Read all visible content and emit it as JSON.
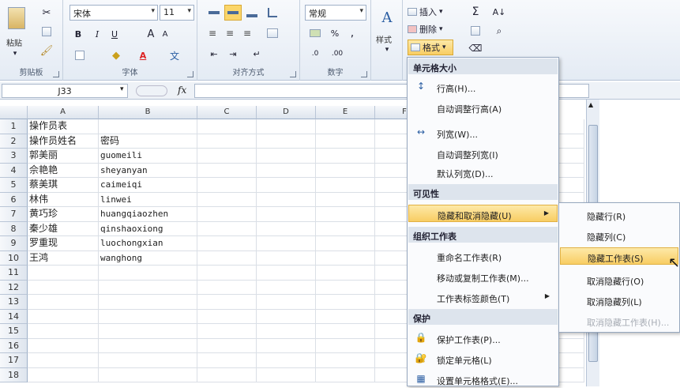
{
  "ribbon": {
    "clipboard": {
      "paste_label": "粘贴",
      "group_label": "剪贴板"
    },
    "font": {
      "font_name": "宋体",
      "font_size": "11",
      "bold": "B",
      "italic": "I",
      "underline": "U",
      "grow": "A",
      "shrink": "A",
      "group_label": "字体"
    },
    "alignment": {
      "group_label": "对齐方式"
    },
    "number": {
      "format_value": "常规",
      "percent": "%",
      "group_label": "数字"
    },
    "styles": {
      "label": "样式"
    },
    "cells": {
      "insert_label": "插入",
      "delete_label": "删除",
      "format_label": "格式"
    }
  },
  "formula_bar": {
    "name_box": "J33",
    "fx": "fx"
  },
  "columns": [
    "A",
    "B",
    "C",
    "D",
    "E",
    "F"
  ],
  "rows": [
    "1",
    "2",
    "3",
    "4",
    "5",
    "6",
    "7",
    "8",
    "9",
    "10",
    "11",
    "12",
    "13",
    "14",
    "15",
    "16",
    "17",
    "18"
  ],
  "cells": [
    {
      "a": "操作员表",
      "b": ""
    },
    {
      "a": "操作员姓名",
      "b": "密码"
    },
    {
      "a": "郭美丽",
      "b": "guomeili"
    },
    {
      "a": "佘艳艳",
      "b": "sheyanyan"
    },
    {
      "a": "蔡美琪",
      "b": "caimeiqi"
    },
    {
      "a": "林伟",
      "b": "linwei"
    },
    {
      "a": "黄巧珍",
      "b": "huangqiaozhen"
    },
    {
      "a": "秦少雄",
      "b": "qinshaoxiong"
    },
    {
      "a": "罗重现",
      "b": "luochongxian"
    },
    {
      "a": "王鸿",
      "b": "wanghong"
    }
  ],
  "format_menu": {
    "section_cell_size": "单元格大小",
    "row_height": "行高(H)...",
    "autofit_row": "自动调整行高(A)",
    "col_width": "列宽(W)...",
    "autofit_col": "自动调整列宽(I)",
    "default_width": "默认列宽(D)...",
    "section_visibility": "可见性",
    "hide_unhide": "隐藏和取消隐藏(U)",
    "section_organize": "组织工作表",
    "rename_sheet": "重命名工作表(R)",
    "move_copy": "移动或复制工作表(M)...",
    "tab_color": "工作表标签颜色(T)",
    "section_protect": "保护",
    "protect_sheet": "保护工作表(P)...",
    "lock_cell": "锁定单元格(L)",
    "format_cells": "设置单元格格式(E)..."
  },
  "sub_menu": {
    "hide_rows": "隐藏行(R)",
    "hide_cols": "隐藏列(C)",
    "hide_sheet": "隐藏工作表(S)",
    "unhide_rows": "取消隐藏行(O)",
    "unhide_cols": "取消隐藏列(L)",
    "unhide_sheet": "取消隐藏工作表(H)..."
  }
}
